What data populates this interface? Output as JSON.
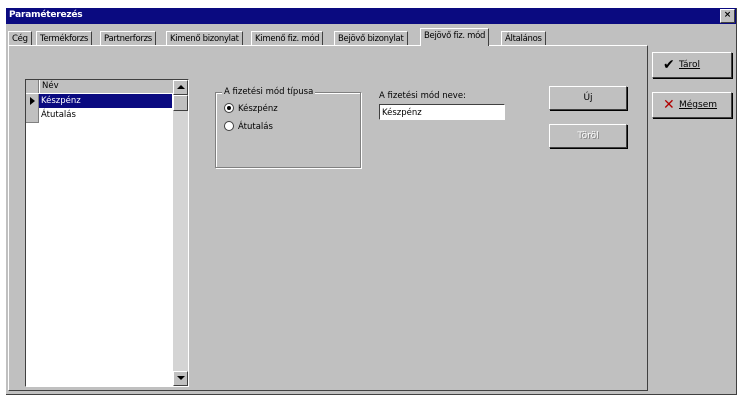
{
  "window": {
    "title": "Paraméterezés",
    "close_label": "×"
  },
  "tabs": [
    {
      "label": "Cég"
    },
    {
      "label": "Termékforzs"
    },
    {
      "label": "Partnerforzs"
    },
    {
      "label": "Kimenő bizonylat"
    },
    {
      "label": "Kimenő fiz. mód"
    },
    {
      "label": "Bejövő bizonylat"
    },
    {
      "label": "Bejövő fiz. mód",
      "active": true
    },
    {
      "label": "Általános"
    }
  ],
  "grid": {
    "column": "Név",
    "rows": [
      {
        "label": "Készpénz",
        "selected": true
      },
      {
        "label": "Átutalás",
        "selected": false
      }
    ]
  },
  "payment_type": {
    "legend": "A fizetési mód típusa",
    "options": [
      {
        "label": "Készpénz",
        "checked": true
      },
      {
        "label": "Átutalás",
        "checked": false
      }
    ]
  },
  "name_field": {
    "label": "A fizetési mód neve:",
    "value": "Készpénz"
  },
  "buttons": {
    "new": "Új",
    "delete": "Töröl"
  },
  "side": {
    "save": "Tárol",
    "cancel": "Mégsem"
  }
}
